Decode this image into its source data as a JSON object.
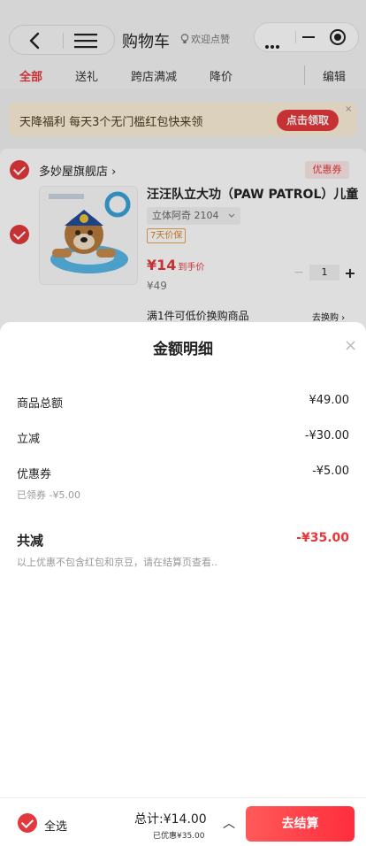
{
  "header": {
    "title": "购物车",
    "welcome": "欢迎点赞"
  },
  "tabs": [
    {
      "label": "全部",
      "active": true
    },
    {
      "label": "送礼",
      "active": false
    },
    {
      "label": "跨店满减",
      "active": false
    },
    {
      "label": "降价",
      "active": false
    }
  ],
  "edit_label": "编辑",
  "banner": {
    "text": "天降福利 每天3个无门槛红包快来领",
    "button": "点击领取",
    "close": "×"
  },
  "shop": {
    "name": "多妙屋旗舰店 ›",
    "coupon_tag": "优惠券",
    "product": {
      "title": "汪汪队立大功（PAW PATROL）儿童",
      "sku": "立体阿奇 2104",
      "guarantee": "7天价保",
      "price": "¥14",
      "price_note": "到手价",
      "original_price": "¥49",
      "quantity": "1"
    },
    "swap_text": "满1件可低价换购商品",
    "swap_link": "去换购 ›"
  },
  "sheet": {
    "title": "金额明细",
    "rows": [
      {
        "label": "商品总额",
        "value": "¥49.00"
      },
      {
        "label": "立减",
        "value": "-¥30.00"
      },
      {
        "label": "优惠券",
        "value": "-¥5.00",
        "sub": "已领券 -¥5.00"
      }
    ],
    "total_label": "共减",
    "total_value": "-¥35.00",
    "note": "以上优惠不包含红包和京豆，请在结算页查看.."
  },
  "bottom": {
    "select_all": "全选",
    "total": "总计:¥14.00",
    "saved": "已优惠¥35.00",
    "checkout": "去结算"
  },
  "colors": {
    "accent": "#e4393c",
    "banner_bg": "#fcf1d8"
  }
}
